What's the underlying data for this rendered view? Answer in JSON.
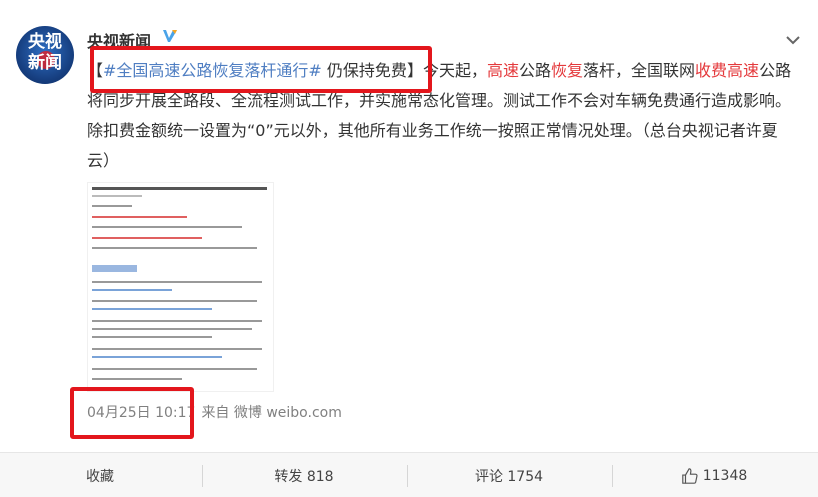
{
  "account": {
    "name": "央视新闻",
    "avatar_lines": [
      "央视",
      "新闻"
    ]
  },
  "post": {
    "bracket_open": "【",
    "topic": "#全国高速公路恢复落杆通行#",
    "headline_rest": " 仍保持免费",
    "bracket_close": "】",
    "body_parts": [
      "今天起，",
      "高速",
      "公路",
      "恢复",
      "落杆，全国联网",
      "收费",
      "高速",
      "公路将同步开展全路段、全流程测试工作，并实施常态化管理。测试工作不会对车辆免费通行造成影响。除扣费金额统一设置为“0”元以外，其他所有业务工作统一按照正常情况处理。（总台央视记者许夏云）"
    ]
  },
  "meta": {
    "time": "04月25日 10:17",
    "source": "来自 微博 weibo.com"
  },
  "footer": {
    "favorite": "收藏",
    "repost": "转发 818",
    "comment": "评论 1754",
    "like": "11348"
  },
  "icons": {
    "verified": "verified-icon",
    "more": "chevron-down-icon",
    "like": "thumbs-up-icon"
  },
  "colors": {
    "highlight": "#e3161c",
    "keyword": "#e4393c",
    "link": "#4f7ec2",
    "verified": "#4aa3e8"
  }
}
